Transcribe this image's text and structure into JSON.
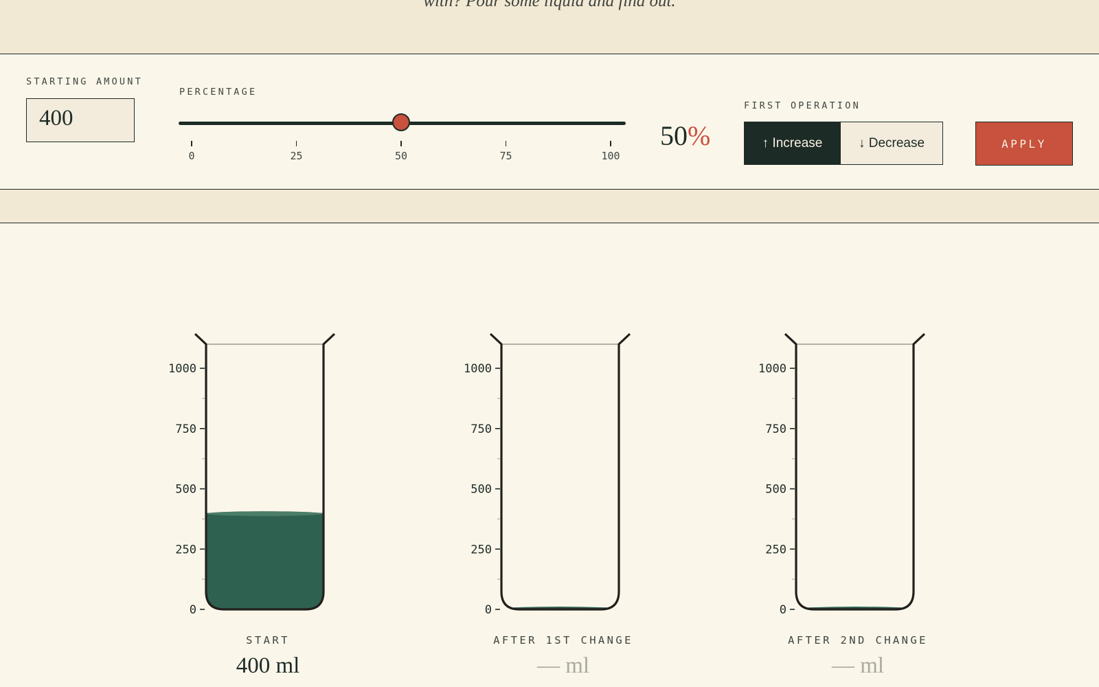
{
  "intro": {
    "text": "with? Pour some liquid and find out."
  },
  "controls": {
    "starting_amount_label": "STARTING AMOUNT",
    "starting_amount_value": "400",
    "percentage_label": "PERCENTAGE",
    "percentage_value": 50,
    "percentage_number": "50",
    "percentage_sign": "%",
    "slider_ticks": [
      "0",
      "25",
      "50",
      "75",
      "100"
    ],
    "first_operation_label": "FIRST OPERATION",
    "operations": [
      {
        "label": "↑ Increase",
        "selected": true
      },
      {
        "label": "↓ Decrease",
        "selected": false
      }
    ],
    "apply_label": "APPLY"
  },
  "beakers": {
    "scale_max": 1100,
    "scale_labels": [
      "1000",
      "750",
      "500",
      "250",
      "0"
    ],
    "items": [
      {
        "caption": "START",
        "value_text": "400 ml",
        "fill_ml": 400
      },
      {
        "caption": "AFTER 1ST CHANGE",
        "value_text": "— ml",
        "fill_ml": 0
      },
      {
        "caption": "AFTER 2ND CHANGE",
        "value_text": "— ml",
        "fill_ml": 0
      }
    ]
  },
  "colors": {
    "background": "#fbf6ea",
    "ink": "#1d2b27",
    "accent": "#c8523d",
    "liquid": "#2e6150",
    "liquid_surface": "#4c7d69"
  }
}
